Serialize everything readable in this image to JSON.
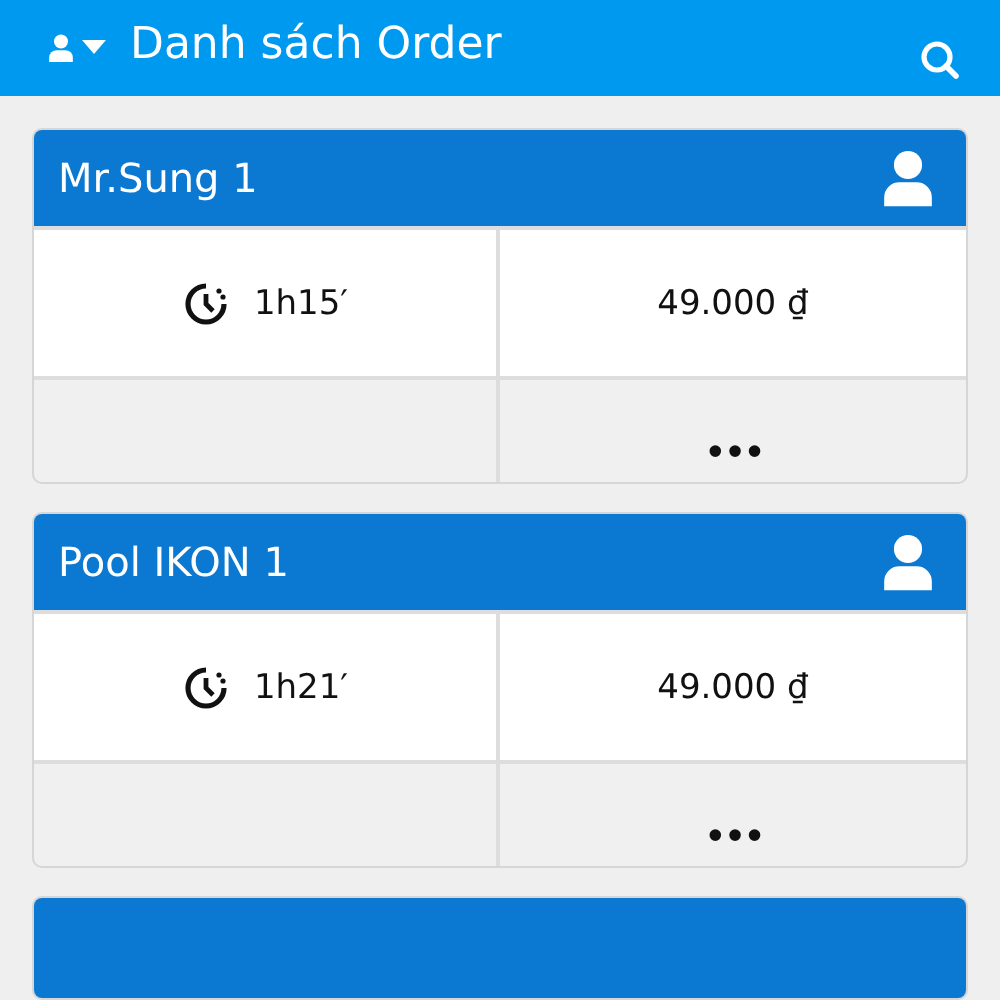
{
  "app_bar": {
    "title": "Danh sách Order"
  },
  "orders": [
    {
      "kind": "card",
      "title": "Mr.Sung 1",
      "duration": "1h15′",
      "amount": "49.000 ₫",
      "more": "•••"
    },
    {
      "kind": "card",
      "title": "Pool IKON 1",
      "duration": "1h21′",
      "amount": "49.000 ₫",
      "more": "•••"
    },
    {
      "kind": "cut"
    }
  ]
}
